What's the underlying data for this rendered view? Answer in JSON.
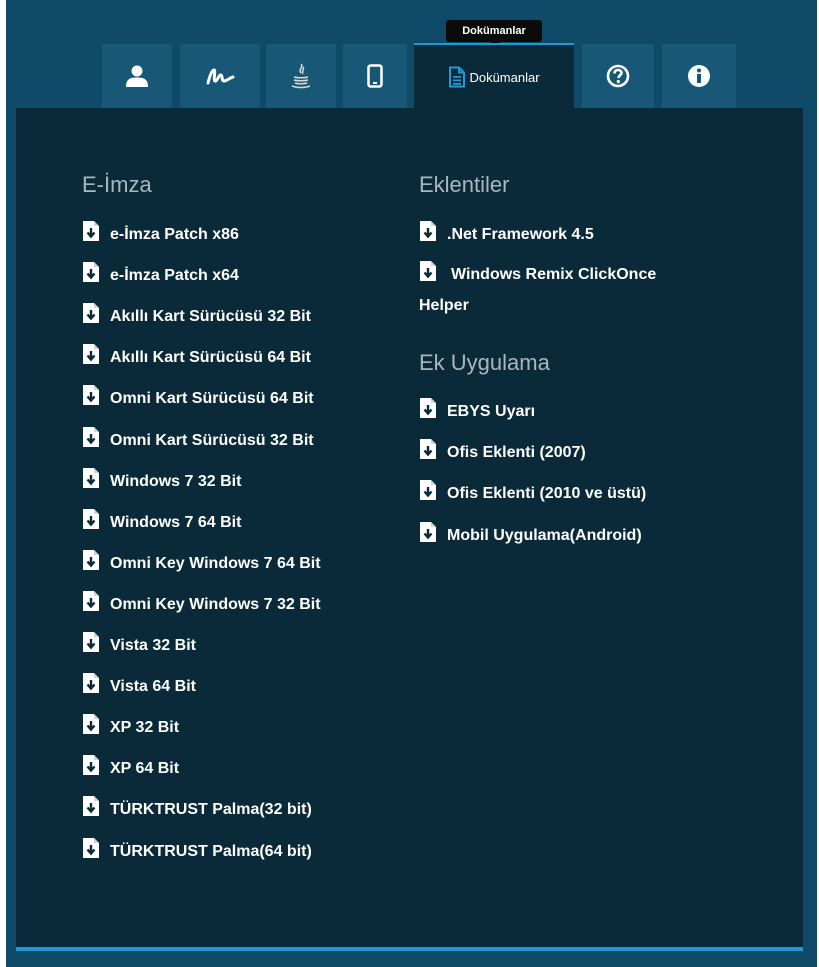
{
  "tooltip": "Dokümanlar",
  "tabs": [
    {
      "icon": "user-icon"
    },
    {
      "icon": "signature-icon"
    },
    {
      "icon": "java-icon"
    },
    {
      "icon": "mobile-icon"
    },
    {
      "icon": "document-icon",
      "label": "Dokümanlar",
      "active": true
    },
    {
      "icon": "help-icon"
    },
    {
      "icon": "info-icon"
    }
  ],
  "eimza": {
    "title": "E-İmza",
    "items": [
      "e-İmza Patch x86",
      "e-İmza Patch x64",
      "Akıllı Kart Sürücüsü 32 Bit",
      "Akıllı Kart Sürücüsü 64 Bit",
      "Omni Kart Sürücüsü 64 Bit",
      "Omni Kart Sürücüsü 32 Bit",
      "Windows 7 32 Bit",
      "Windows 7 64 Bit",
      "Omni Key Windows 7 64 Bit",
      "Omni Key Windows 7 32 Bit",
      "Vista 32 Bit",
      "Vista 64 Bit",
      "XP 32 Bit",
      "XP 64 Bit",
      "TÜRKTRUST Palma(32 bit)",
      "TÜRKTRUST Palma(64 bit)"
    ]
  },
  "eklentiler": {
    "title": "Eklentiler",
    "items": [
      ".Net Framework 4.5",
      "Windows Remix ClickOnce Helper"
    ]
  },
  "ek_uygulama": {
    "title": "Ek Uygulama",
    "items": [
      "EBYS Uyarı",
      "Ofis Eklenti (2007)",
      "Ofis Eklenti (2010 ve üstü)",
      "Mobil Uygulama(Android)"
    ]
  },
  "colors": {
    "frame": "#0f4a68",
    "tab": "#185776",
    "panel": "#0a2a3a",
    "accent": "#1e9ad6",
    "section_title": "#a9b6be"
  }
}
